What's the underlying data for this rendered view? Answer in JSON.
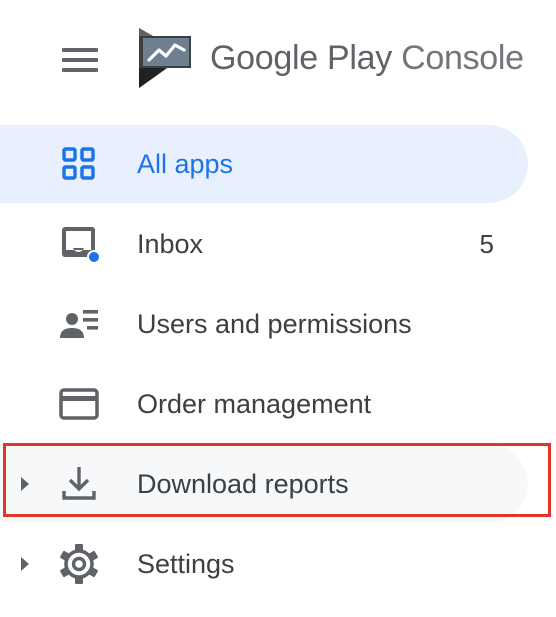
{
  "header": {
    "brand_google_play": "Google Play",
    "brand_console": "Console"
  },
  "nav": {
    "items": [
      {
        "label": "All apps",
        "icon": "grid-icon",
        "active": true
      },
      {
        "label": "Inbox",
        "icon": "inbox-icon",
        "badge": "5"
      },
      {
        "label": "Users and permissions",
        "icon": "users-list-icon"
      },
      {
        "label": "Order management",
        "icon": "credit-card-icon"
      },
      {
        "label": "Download reports",
        "icon": "download-icon",
        "expandable": true,
        "highlighted": true
      },
      {
        "label": "Settings",
        "icon": "gear-icon",
        "expandable": true
      }
    ]
  },
  "colors": {
    "accent": "#1a73e8",
    "active_bg": "#e8f0fe",
    "text": "#3c4043",
    "icon": "#5f6368",
    "highlight_border": "#e3362b",
    "notification_dot": "#1a73e8"
  }
}
